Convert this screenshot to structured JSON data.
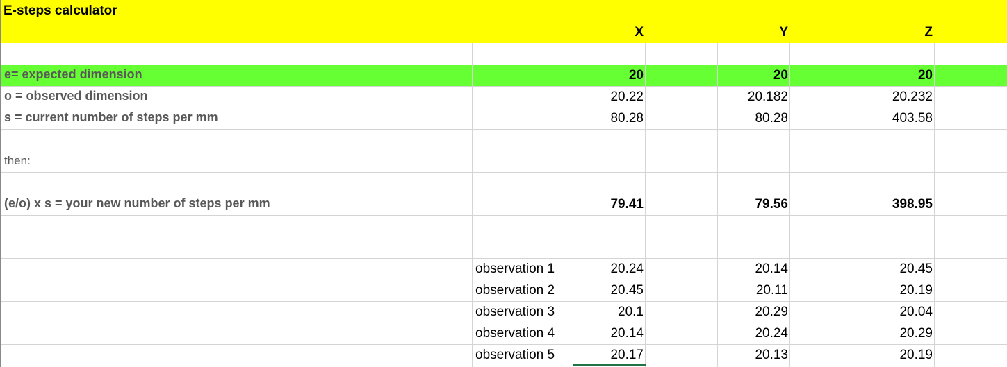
{
  "title": "E-steps calculator",
  "axes": [
    "X",
    "Y",
    "Z"
  ],
  "rows": {
    "expected": {
      "label": "e= expected dimension",
      "values": [
        "20",
        "20",
        "20"
      ]
    },
    "observed": {
      "label": "o = observed dimension",
      "values": [
        "20.22",
        "20.182",
        "20.232"
      ]
    },
    "steps": {
      "label": "s = current number of steps per mm",
      "values": [
        "80.28",
        "80.28",
        "403.58"
      ]
    },
    "then": {
      "label": "then:"
    },
    "result": {
      "label": "(e/o) x s = your new number of steps per mm",
      "values": [
        "79.41",
        "79.56",
        "398.95"
      ]
    }
  },
  "observations": [
    {
      "label": "observation 1",
      "values": [
        "20.24",
        "20.14",
        "20.45"
      ]
    },
    {
      "label": "observation 2",
      "values": [
        "20.45",
        "20.11",
        "20.19"
      ]
    },
    {
      "label": "observation 3",
      "values": [
        "20.1",
        "20.29",
        "20.04"
      ]
    },
    {
      "label": "observation 4",
      "values": [
        "20.14",
        "20.24",
        "20.29"
      ]
    },
    {
      "label": "observation 5",
      "values": [
        "20.17",
        "20.13",
        "20.19"
      ]
    }
  ],
  "colors": {
    "header": "#ffff00",
    "expected_row": "#66ff33",
    "selection": "#217346"
  }
}
